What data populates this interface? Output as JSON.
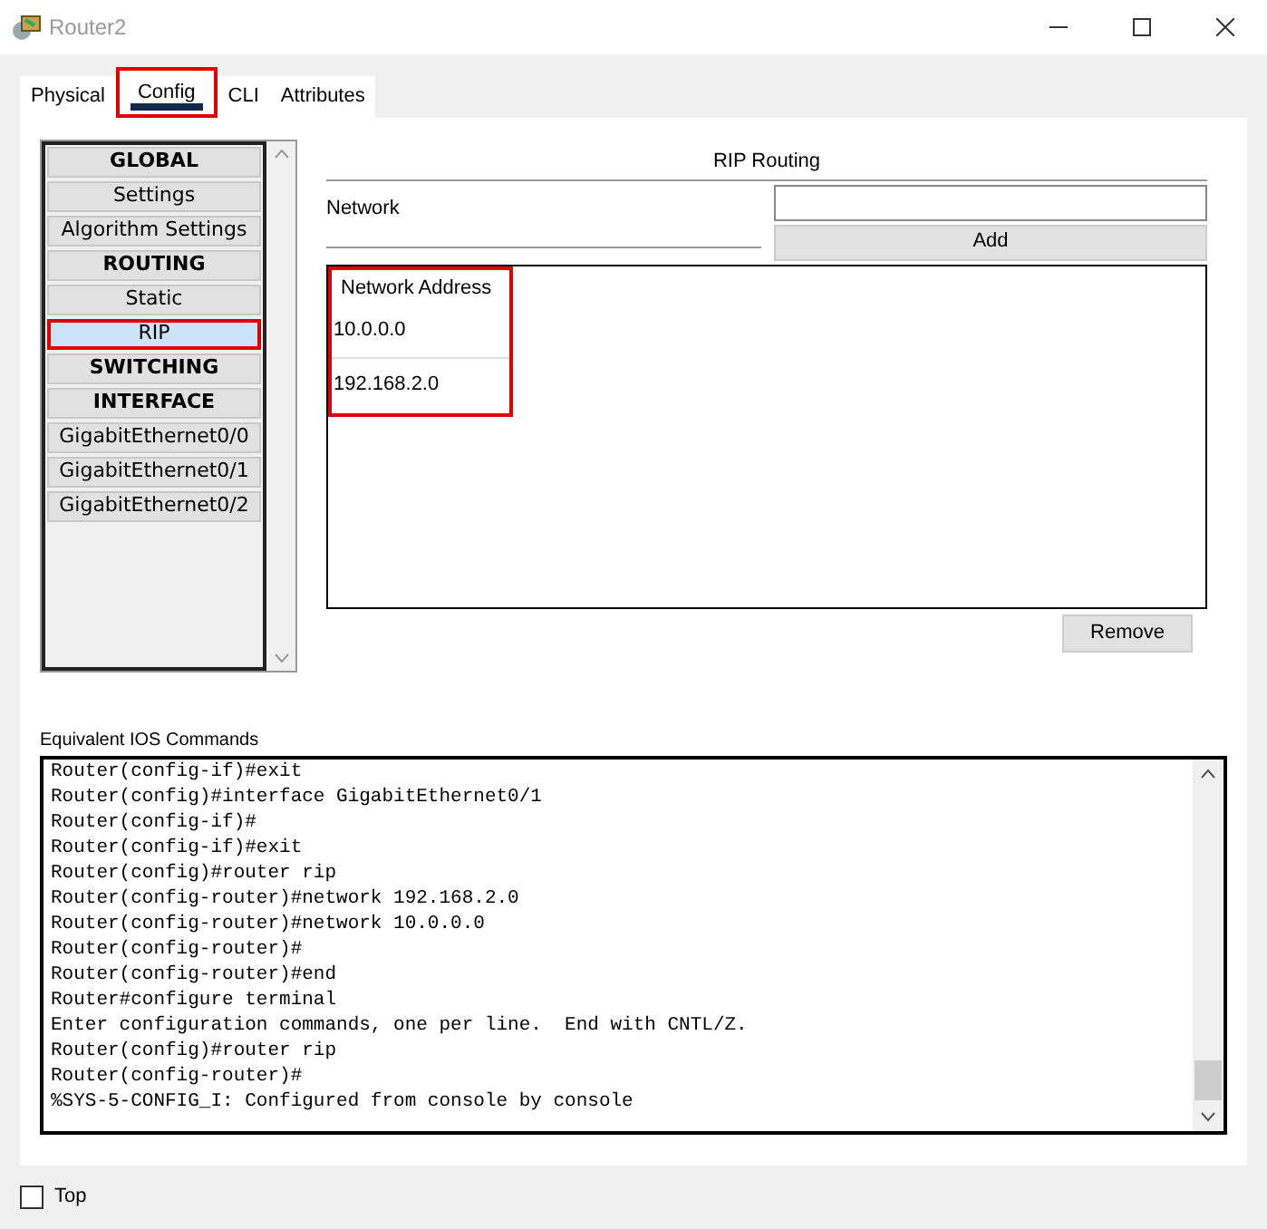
{
  "window": {
    "title": "Router2"
  },
  "tabs": [
    {
      "label": "Physical",
      "selected": false,
      "highlighted": false
    },
    {
      "label": "Config",
      "selected": true,
      "highlighted": true
    },
    {
      "label": "CLI",
      "selected": false,
      "highlighted": false
    },
    {
      "label": "Attributes",
      "selected": false,
      "highlighted": false
    }
  ],
  "sidebar": {
    "items": [
      {
        "kind": "header",
        "label": "GLOBAL",
        "selected": false
      },
      {
        "kind": "item",
        "label": "Settings",
        "selected": false
      },
      {
        "kind": "item",
        "label": "Algorithm Settings",
        "selected": false
      },
      {
        "kind": "header",
        "label": "ROUTING",
        "selected": false
      },
      {
        "kind": "item",
        "label": "Static",
        "selected": false
      },
      {
        "kind": "item",
        "label": "RIP",
        "selected": true
      },
      {
        "kind": "header",
        "label": "SWITCHING",
        "selected": false
      },
      {
        "kind": "header",
        "label": "INTERFACE",
        "selected": false
      },
      {
        "kind": "item",
        "label": "GigabitEthernet0/0",
        "selected": false
      },
      {
        "kind": "item",
        "label": "GigabitEthernet0/1",
        "selected": false
      },
      {
        "kind": "item",
        "label": "GigabitEthernet0/2",
        "selected": false
      }
    ]
  },
  "rip": {
    "title": "RIP Routing",
    "network_label": "Network",
    "add_button": "Add",
    "column": "Network Address",
    "rows": [
      "10.0.0.0",
      "192.168.2.0"
    ],
    "remove_button": "Remove"
  },
  "console": {
    "label": "Equivalent IOS Commands",
    "lines": [
      "Router(config-if)#exit",
      "Router(config)#interface GigabitEthernet0/1",
      "Router(config-if)#",
      "Router(config-if)#exit",
      "Router(config)#router rip",
      "Router(config-router)#network 192.168.2.0",
      "Router(config-router)#network 10.0.0.0",
      "Router(config-router)#",
      "Router(config-router)#end",
      "Router#configure terminal",
      "Enter configuration commands, one per line.  End with CNTL/Z.",
      "Router(config)#router rip",
      "Router(config-router)#",
      "%SYS-5-CONFIG_I: Configured from console by console"
    ]
  },
  "top_checkbox": {
    "label": "Top",
    "checked": false
  }
}
